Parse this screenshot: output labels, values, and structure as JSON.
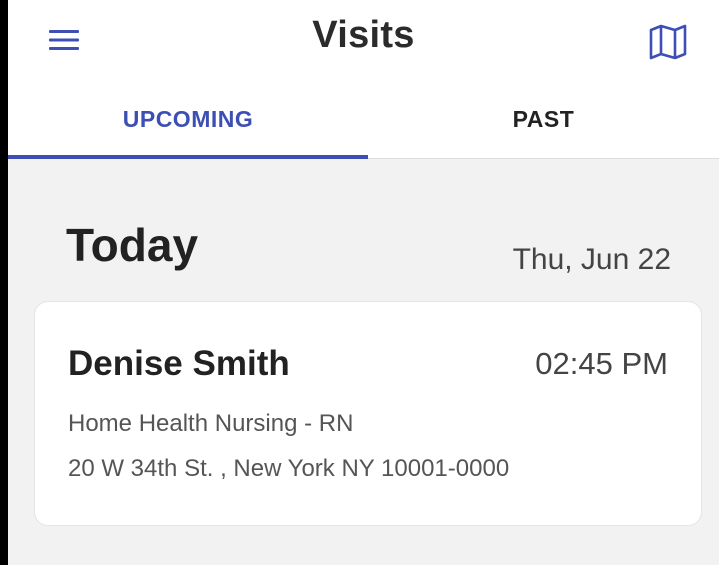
{
  "header": {
    "title": "Visits",
    "menu_icon": "hamburger-menu-icon",
    "map_icon": "map-icon"
  },
  "tabs": [
    {
      "label": "UPCOMING",
      "active": true
    },
    {
      "label": "PAST",
      "active": false
    }
  ],
  "section": {
    "title": "Today",
    "date": "Thu, Jun 22"
  },
  "visits": [
    {
      "name": "Denise Smith",
      "time": "02:45 PM",
      "service": "Home Health Nursing - RN",
      "address": "20 W 34th St. , New York NY 10001-0000"
    }
  ],
  "colors": {
    "accent": "#3d4eb5",
    "background": "#f2f2f2",
    "card": "#ffffff"
  }
}
